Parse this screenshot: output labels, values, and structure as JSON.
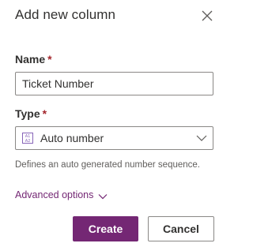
{
  "panel": {
    "title": "Add new column",
    "close_icon": "close-icon"
  },
  "name_field": {
    "label": "Name",
    "required_marker": "*",
    "value": "Ticket Number"
  },
  "type_field": {
    "label": "Type",
    "required_marker": "*",
    "icon": "auto-number-icon",
    "icon_text": "A1 A2",
    "value": "Auto number",
    "hint": "Defines an auto generated number sequence."
  },
  "advanced": {
    "label": "Advanced options"
  },
  "buttons": {
    "create": "Create",
    "cancel": "Cancel"
  },
  "colors": {
    "accent": "#742774",
    "required": "#a4262c",
    "border": "#8a8886"
  }
}
